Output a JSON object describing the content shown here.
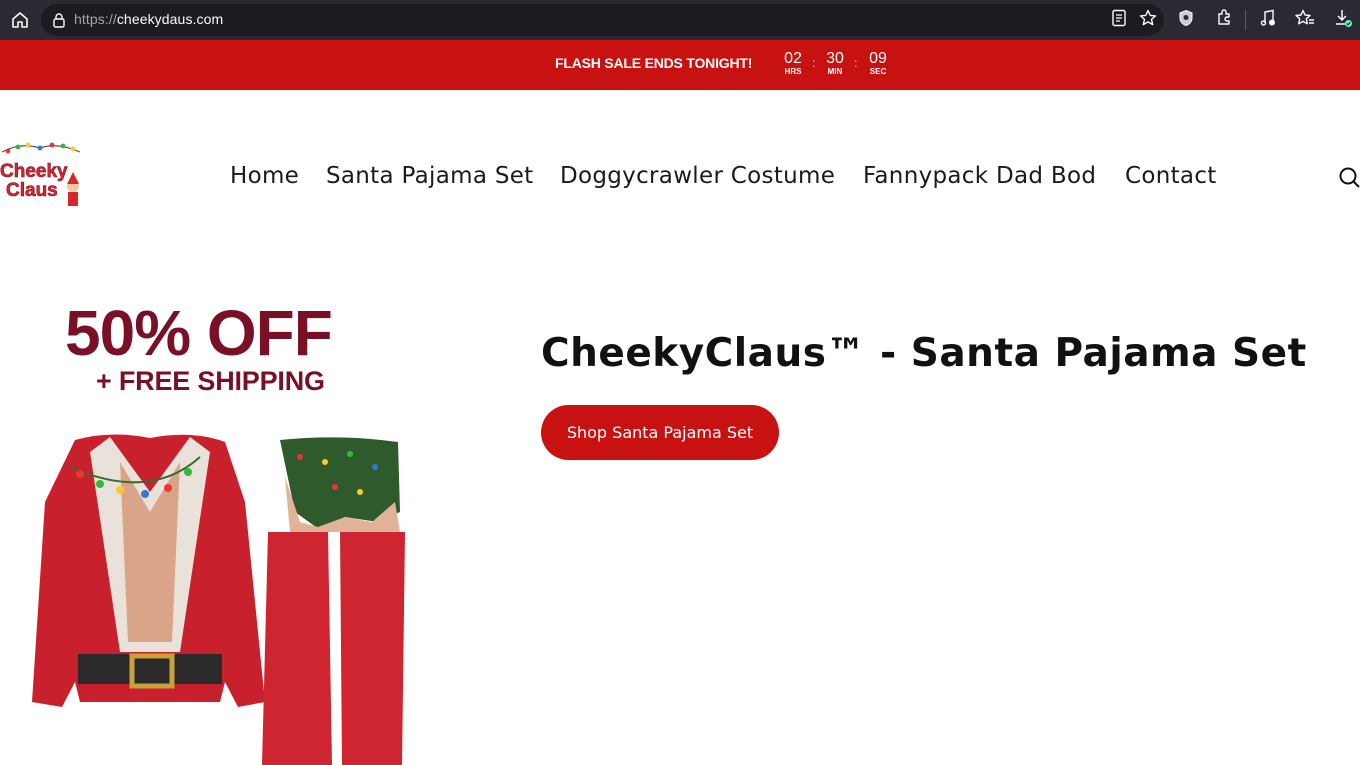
{
  "browser": {
    "url_protocol": "https://",
    "url_domain": "cheekydaus.com",
    "icons": [
      "home-icon",
      "lock-icon",
      "reader-view-icon",
      "bookmark-star-icon",
      "shield-icon",
      "extensions-icon",
      "media-icon",
      "favorites-icon",
      "download-icon"
    ]
  },
  "flash_sale": {
    "text": "FLASH SALE ENDS TONIGHT!",
    "hours": "02",
    "hours_label": "HRS",
    "minutes": "30",
    "minutes_label": "MIN",
    "seconds": "09",
    "seconds_label": "SEC",
    "background_color": "#c81111"
  },
  "header": {
    "logo_text": "Cheeky Claus",
    "nav": [
      {
        "label": "Home"
      },
      {
        "label": "Santa Pajama Set"
      },
      {
        "label": "Doggycrawler Costume"
      },
      {
        "label": "Fannypack Dad Bod"
      },
      {
        "label": "Contact"
      }
    ]
  },
  "hero": {
    "promo_headline": "50% OFF",
    "promo_subline": "+ FREE SHIPPING",
    "title": "CheekyClaus™ - Santa Pajama Set",
    "button_label": "Shop Santa Pajama Set",
    "accent_color": "#c81111",
    "promo_color": "#7a1026"
  }
}
